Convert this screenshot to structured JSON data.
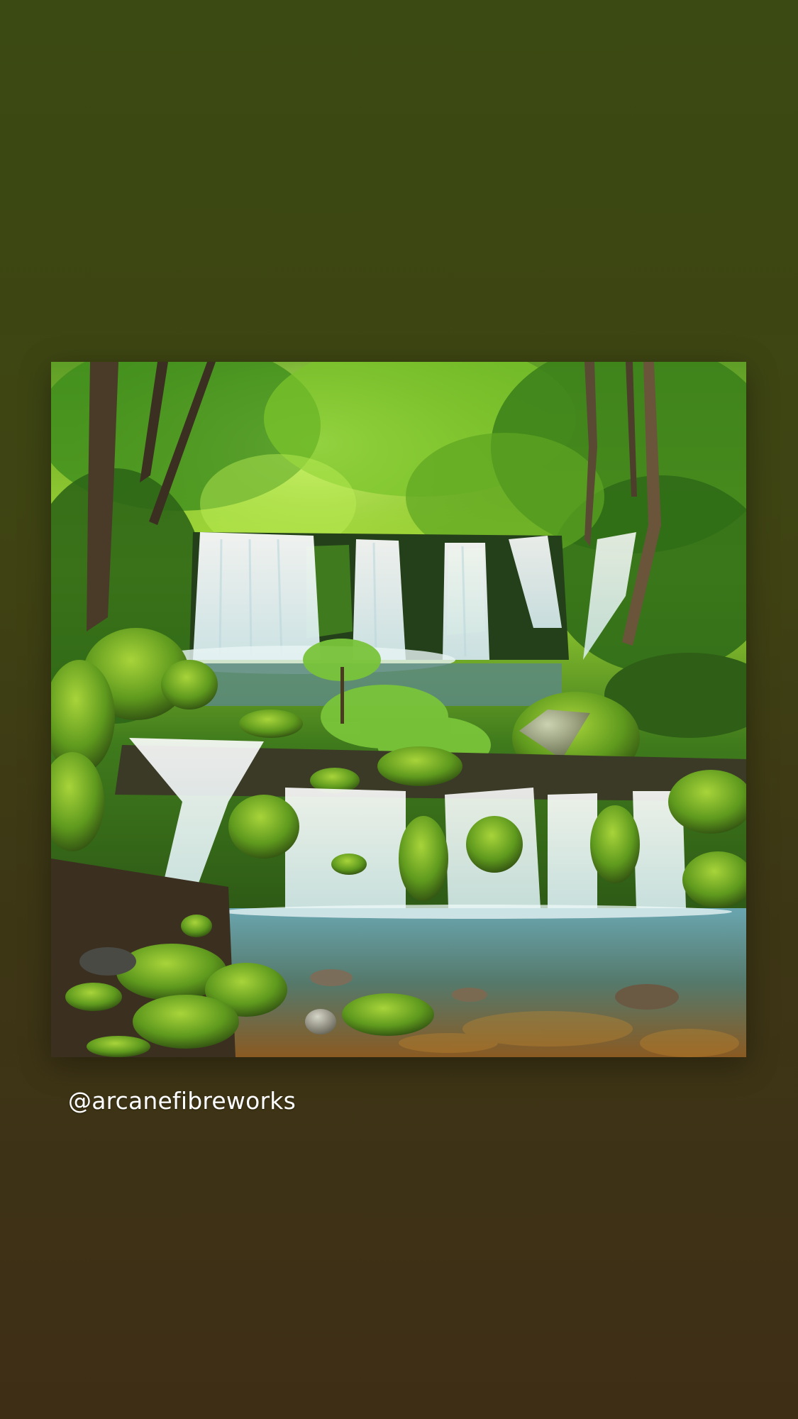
{
  "story": {
    "username_sticker": "@arcanefibreworks",
    "photo_subject_icon": "waterfall-forest-photo"
  },
  "colors": {
    "background_top": "#3b4a12",
    "background_bottom": "#3e2e16",
    "text": "#ffffff"
  }
}
